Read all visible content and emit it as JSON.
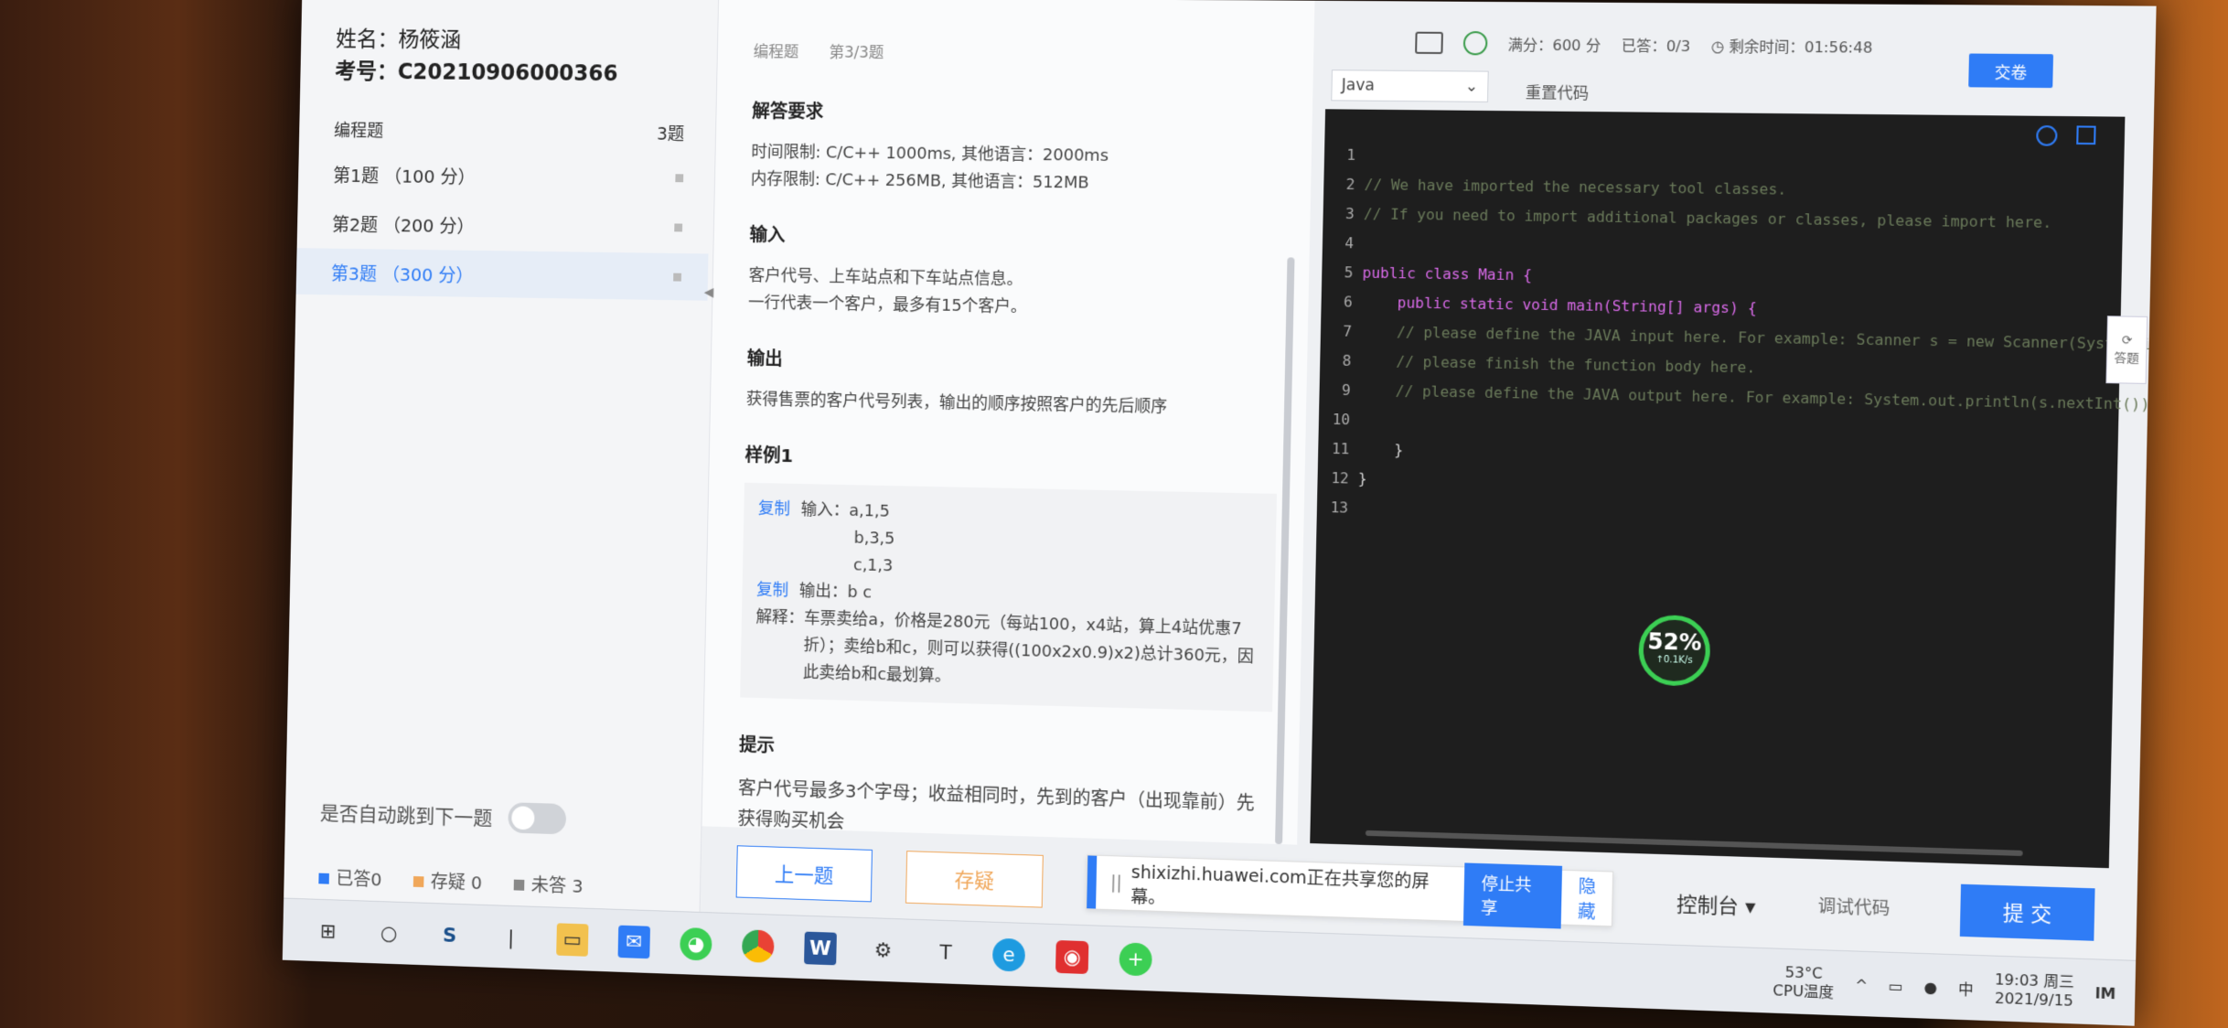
{
  "candidate": {
    "name": "姓名：杨筱涵",
    "exam_id": "考号：C20210906000366"
  },
  "sidebar": {
    "category": "编程题",
    "count": "3题",
    "items": [
      {
        "label": "第1题  （100 分）"
      },
      {
        "label": "第2题  （200 分）"
      },
      {
        "label": "第3题  （300 分）"
      }
    ],
    "auto_next": "是否自动跳到下一题",
    "legend": [
      {
        "label": "已答0",
        "color": "#2f7cf6"
      },
      {
        "label": "存疑 0",
        "color": "#f0a75a"
      },
      {
        "label": "未答 3",
        "color": "#888888"
      }
    ]
  },
  "breadcrumb": {
    "type": "编程题",
    "progress": "第3/3题"
  },
  "problem": {
    "req_title": "解答要求",
    "time_limit": "时间限制: C/C++ 1000ms, 其他语言：2000ms",
    "mem_limit": "内存限制: C/C++ 256MB, 其他语言：512MB",
    "input_title": "输入",
    "input_1": "客户代号、上车站点和下车站点信息。",
    "input_2": "一行代表一个客户，最多有15个客户。",
    "output_title": "输出",
    "output_1": "获得售票的客户代号列表，输出的顺序按照客户的先后顺序",
    "sample_title": "样例1",
    "copy": "复制",
    "input_label": "输入：",
    "in_1": "a,1,5",
    "in_2": "b,3,5",
    "in_3": "c,1,3",
    "output_label": "输出：",
    "out_1": "b c",
    "explain_label": "解释：",
    "explain": "车票卖给a，价格是280元（每站100，x4站，算上4站优惠7折）；卖给b和c，则可以获得((100x2x0.9)x2)总计360元，因此卖给b和c最划算。",
    "hint_title": "提示",
    "hint": "客户代号最多3个字母；收益相同时，先到的客户（出现靠前）先获得购买机会"
  },
  "topbar": {
    "full_score": "满分：600 分",
    "answered": "已答：0/3",
    "remaining": "剩余时间：01:56:48",
    "handin": "交卷",
    "language": "Java",
    "reset": "重置代码"
  },
  "editor": {
    "lines": [
      {
        "n": "1",
        "t": ""
      },
      {
        "n": "2",
        "t": "// We have imported the necessary tool classes."
      },
      {
        "n": "3",
        "t": "// If you need to import additional packages or classes, please import here."
      },
      {
        "n": "4",
        "t": ""
      },
      {
        "n": "5",
        "t": "public class Main {"
      },
      {
        "n": "6",
        "t": "    public static void main(String[] args) {"
      },
      {
        "n": "7",
        "t": "    // please define the JAVA input here. For example: Scanner s = new Scanner(System.in);"
      },
      {
        "n": "8",
        "t": "    // please finish the function body here."
      },
      {
        "n": "9",
        "t": "    // please define the JAVA output here. For example: System.out.println(s.nextInt());"
      },
      {
        "n": "10",
        "t": ""
      },
      {
        "n": "11",
        "t": "    }"
      },
      {
        "n": "12",
        "t": "}"
      },
      {
        "n": "13",
        "t": ""
      }
    ],
    "side_tab": "答题",
    "meter_pct": "52%",
    "meter_sub": "↑0.1K/s"
  },
  "bottom": {
    "prev": "上一题",
    "doubt": "存疑",
    "share_text": "shixizhi.huawei.com正在共享您的屏幕。",
    "stop_share": "停止共享",
    "hide": "隐藏",
    "console": "控制台 ▾",
    "debug": "调试代码",
    "submit": "提 交"
  },
  "taskbar": {
    "temp": "53°C",
    "temp_label": "CPU温度",
    "ime": "中",
    "time": "19:03 周三",
    "date": "2021/9/15"
  }
}
